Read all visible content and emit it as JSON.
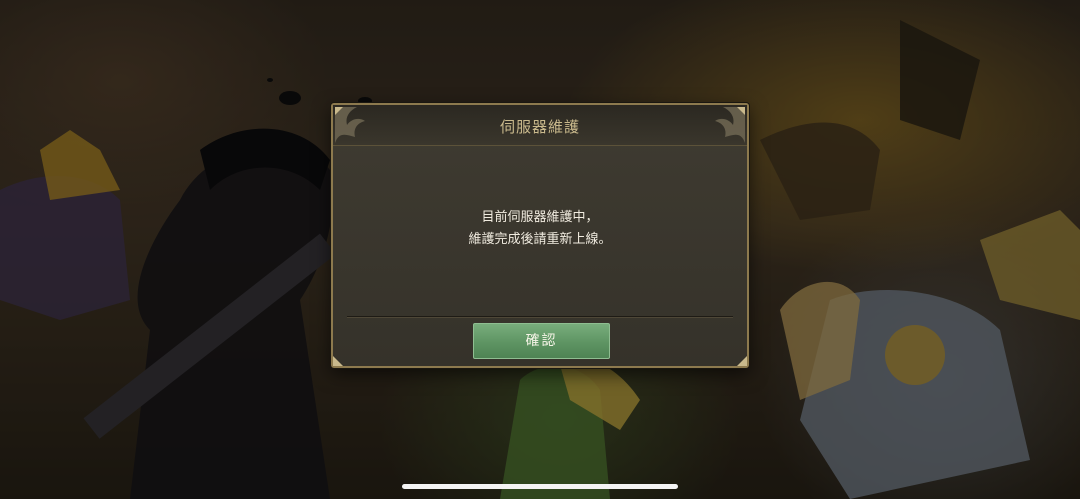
{
  "dialog": {
    "title": "伺服器維護",
    "message_line1": "目前伺服器維護中，",
    "message_line2": "維護完成後請重新上線。",
    "confirm_label": "確認"
  },
  "colors": {
    "dialog_border": "#8d7a4e",
    "title_text": "#c9b98c",
    "button_green": "#5e9463"
  }
}
